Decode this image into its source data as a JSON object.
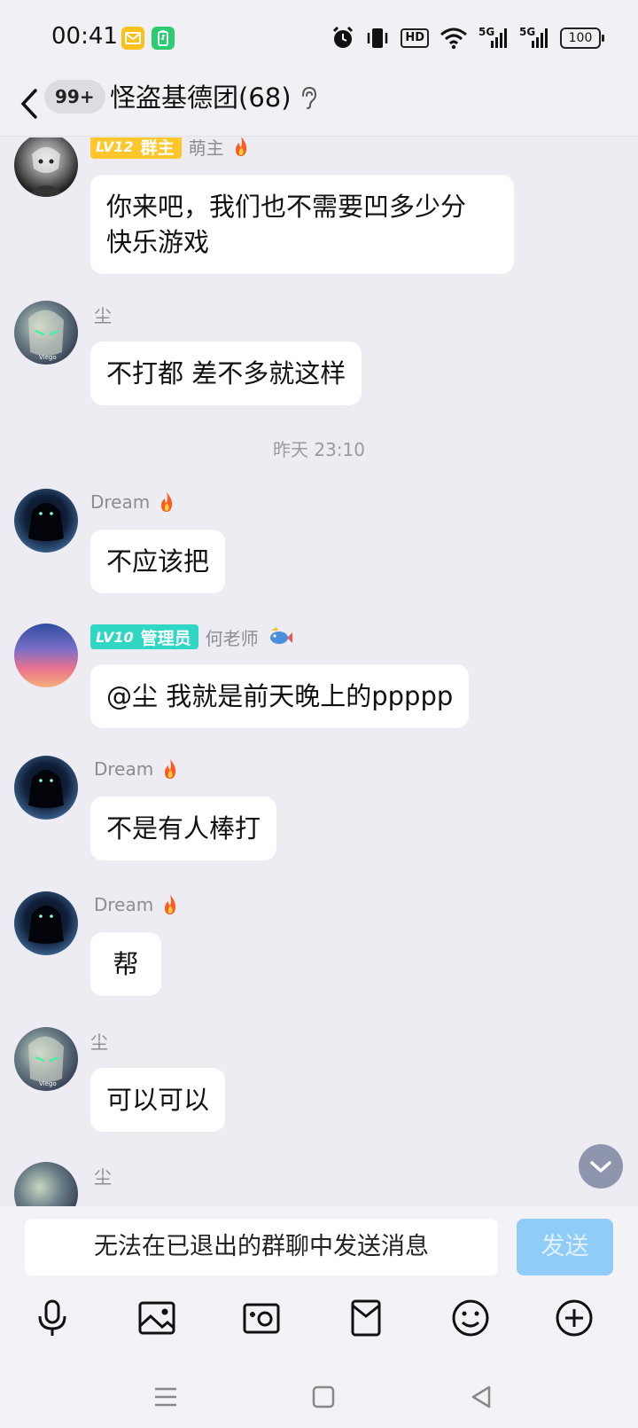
{
  "status_bar": {
    "time": "00:41",
    "battery": "100",
    "network_label": "5G",
    "hd_label": "HD",
    "icons": [
      "mail-notification-icon",
      "battery-saver-icon",
      "alarm-icon",
      "vibrate-icon",
      "hd-icon",
      "wifi-icon",
      "signal-5g-icon",
      "signal-5g-icon",
      "battery-icon"
    ]
  },
  "header": {
    "unread": "99+",
    "title": "怪盗基德团(68)"
  },
  "messages": [
    {
      "sender": "萌主",
      "badge_level": "LV12",
      "badge_role": "群主",
      "text": "你来吧，我们也不需要凹多少分\n快乐游戏"
    },
    {
      "sender": "尘",
      "text": "不打都 差不多就这样"
    },
    {
      "timestamp": "昨天 23:10"
    },
    {
      "sender": "Dream",
      "text": "不应该把"
    },
    {
      "sender": "何老师",
      "badge_level": "LV10",
      "badge_role": "管理员",
      "text": "@尘 我就是前天晚上的ppppp"
    },
    {
      "sender": "Dream",
      "text": "不是有人棒打"
    },
    {
      "sender": "Dream",
      "text": "帮"
    },
    {
      "sender": "尘",
      "text": "可以可以"
    },
    {
      "sender": "尘"
    }
  ],
  "input": {
    "placeholder": "无法在已退出的群聊中发送消息",
    "send_label": "发送"
  },
  "colors": {
    "background": "#ececf2",
    "owner_badge": "#ffc72c",
    "admin_badge": "#2fd7c4",
    "send_disabled": "#8fcdf8"
  }
}
